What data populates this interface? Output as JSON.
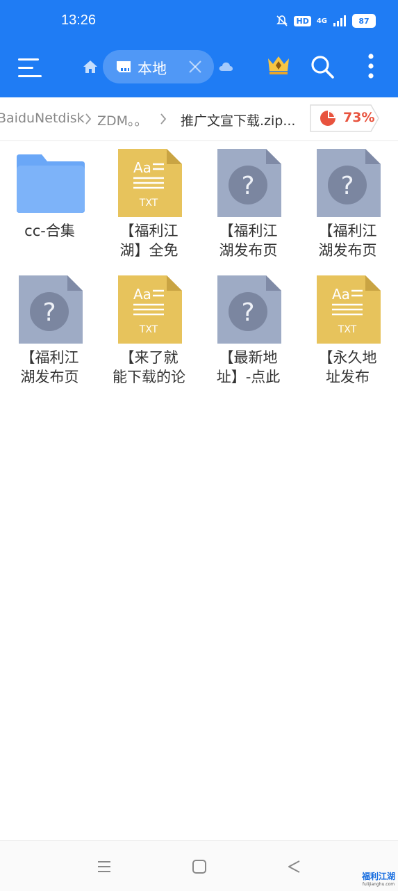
{
  "status_bar": {
    "time": "13:26",
    "battery": "87",
    "network": "4G",
    "hd": "HD"
  },
  "toolbar": {
    "tab_label": "本地",
    "icons": [
      "menu-icon",
      "home-icon",
      "sd-card-icon",
      "close-icon",
      "cloud-icon",
      "crown-icon",
      "search-icon",
      "more-icon"
    ]
  },
  "breadcrumb": {
    "items": [
      "BaiduNetdisk",
      "ZDM。。",
      "推广文宣下载.zip..."
    ],
    "storage_percent": "73%"
  },
  "files": [
    {
      "name_line1": "cc-合集",
      "name_line2": "",
      "type": "folder"
    },
    {
      "name_line1": "【福利江",
      "name_line2": "湖】全免",
      "type": "txt"
    },
    {
      "name_line1": "【福利江",
      "name_line2": "湖发布页",
      "type": "unknown"
    },
    {
      "name_line1": "【福利江",
      "name_line2": "湖发布页",
      "type": "unknown"
    },
    {
      "name_line1": "【福利江",
      "name_line2": "湖发布页",
      "type": "unknown"
    },
    {
      "name_line1": "【来了就",
      "name_line2": "能下载的论",
      "type": "txt"
    },
    {
      "name_line1": "【最新地",
      "name_line2": "址】-点此",
      "type": "unknown"
    },
    {
      "name_line1": "【永久地",
      "name_line2": "址发布",
      "type": "txt"
    }
  ],
  "file_icon_text": {
    "aa": "Aa",
    "txt": "TXT",
    "question": "?"
  },
  "nav": {
    "icons": [
      "recent-apps-icon",
      "home-square-icon",
      "back-icon"
    ]
  },
  "watermark": {
    "title": "福利江湖",
    "url": "fulijianghu.com"
  },
  "colors": {
    "accent": "#1f7cf4",
    "folder": "#6aa7f7",
    "txt": "#e7c35c",
    "unknown": "#9eabc5",
    "storage": "#e8533e"
  }
}
